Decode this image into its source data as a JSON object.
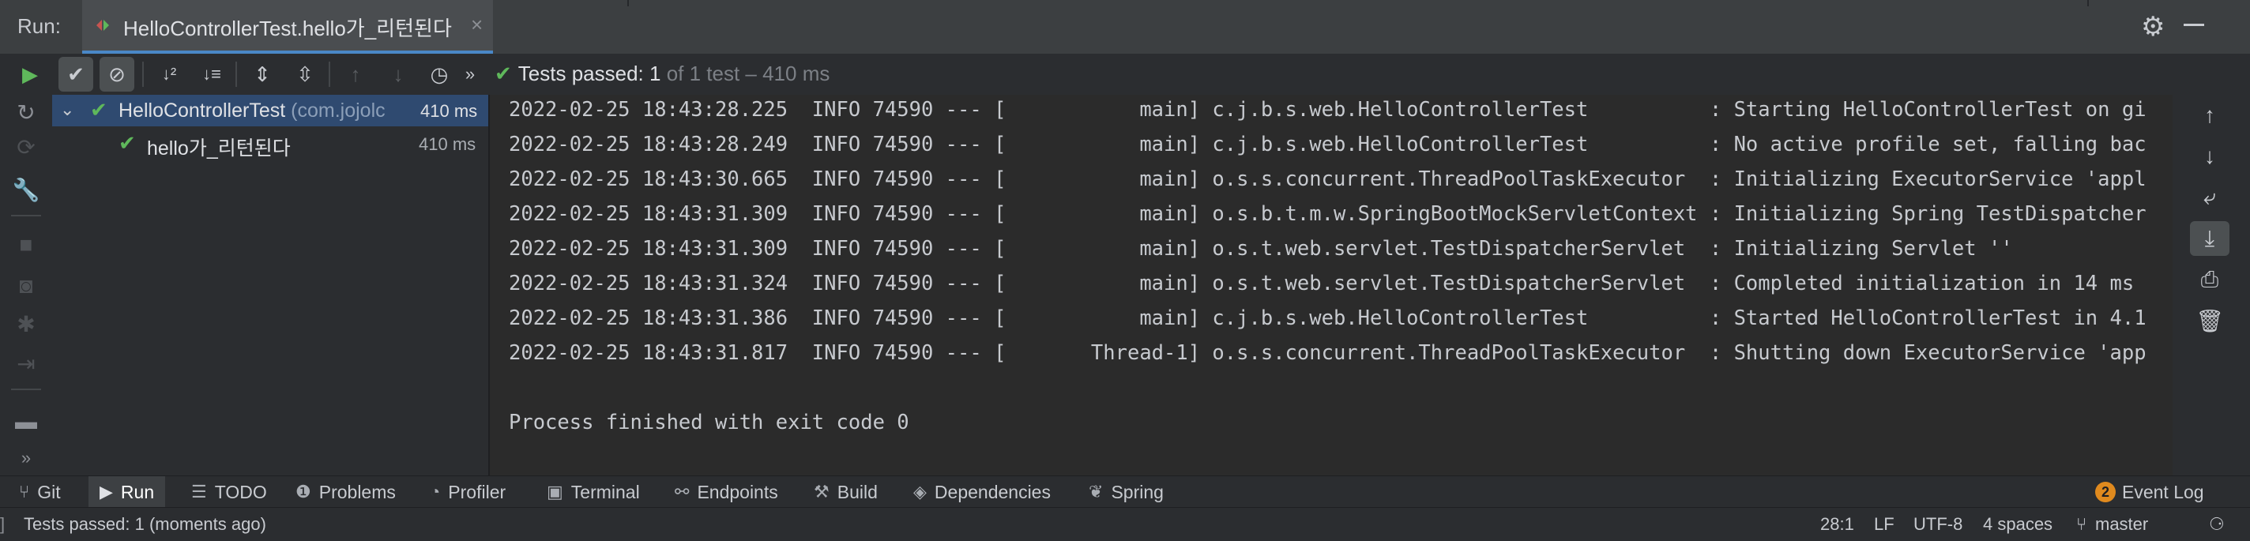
{
  "run_panel": {
    "label": "Run:",
    "tab_title": "HelloControllerTest.hello가_리턴된다",
    "tab_close": "×",
    "gear_icon": "gear-icon",
    "minimize_icon": "minimize-icon"
  },
  "test_status": {
    "passed_label": "Tests passed: 1",
    "total_label": "of 1 test – 410 ms"
  },
  "test_tree": {
    "root": {
      "name": "HelloControllerTest",
      "package": "(com.jojolc",
      "time": "410 ms"
    },
    "child": {
      "name": "hello가_리턴된다",
      "time": "410 ms"
    }
  },
  "console": {
    "lines": [
      "2022-02-25 18:43:28.225  INFO 74590 --- [           main] c.j.b.s.web.HelloControllerTest          : Starting HelloControllerTest on gi",
      "2022-02-25 18:43:28.249  INFO 74590 --- [           main] c.j.b.s.web.HelloControllerTest          : No active profile set, falling bac",
      "2022-02-25 18:43:30.665  INFO 74590 --- [           main] o.s.s.concurrent.ThreadPoolTaskExecutor  : Initializing ExecutorService 'appl",
      "2022-02-25 18:43:31.309  INFO 74590 --- [           main] o.s.b.t.m.w.SpringBootMockServletContext : Initializing Spring TestDispatcher",
      "2022-02-25 18:43:31.309  INFO 74590 --- [           main] o.s.t.web.servlet.TestDispatcherServlet  : Initializing Servlet ''",
      "2022-02-25 18:43:31.324  INFO 74590 --- [           main] o.s.t.web.servlet.TestDispatcherServlet  : Completed initialization in 14 ms",
      "2022-02-25 18:43:31.386  INFO 74590 --- [           main] c.j.b.s.web.HelloControllerTest          : Started HelloControllerTest in 4.1",
      "2022-02-25 18:43:31.817  INFO 74590 --- [       Thread-1] o.s.s.concurrent.ThreadPoolTaskExecutor  : Shutting down ExecutorService 'app",
      "",
      "Process finished with exit code 0"
    ]
  },
  "tool_windows": [
    {
      "label": "Git",
      "icon": "git-branch-icon"
    },
    {
      "label": "Run",
      "icon": "play-icon"
    },
    {
      "label": "TODO",
      "icon": "list-icon"
    },
    {
      "label": "Problems",
      "icon": "info-circle-icon"
    },
    {
      "label": "Profiler",
      "icon": "profiler-icon"
    },
    {
      "label": "Terminal",
      "icon": "terminal-icon"
    },
    {
      "label": "Endpoints",
      "icon": "endpoints-icon"
    },
    {
      "label": "Build",
      "icon": "hammer-icon"
    },
    {
      "label": "Dependencies",
      "icon": "layers-icon"
    },
    {
      "label": "Spring",
      "icon": "spring-leaf-icon"
    }
  ],
  "event_log": {
    "count": "2",
    "label": "Event Log"
  },
  "status_bar": {
    "message": "Tests passed: 1 (moments ago)",
    "position": "28:1",
    "line_sep": "LF",
    "encoding": "UTF-8",
    "indent": "4 spaces",
    "branch": "master"
  },
  "colors": {
    "pass_green": "#5fb85b",
    "selection_blue": "#2f4a70",
    "badge_orange": "#e08a1e"
  }
}
